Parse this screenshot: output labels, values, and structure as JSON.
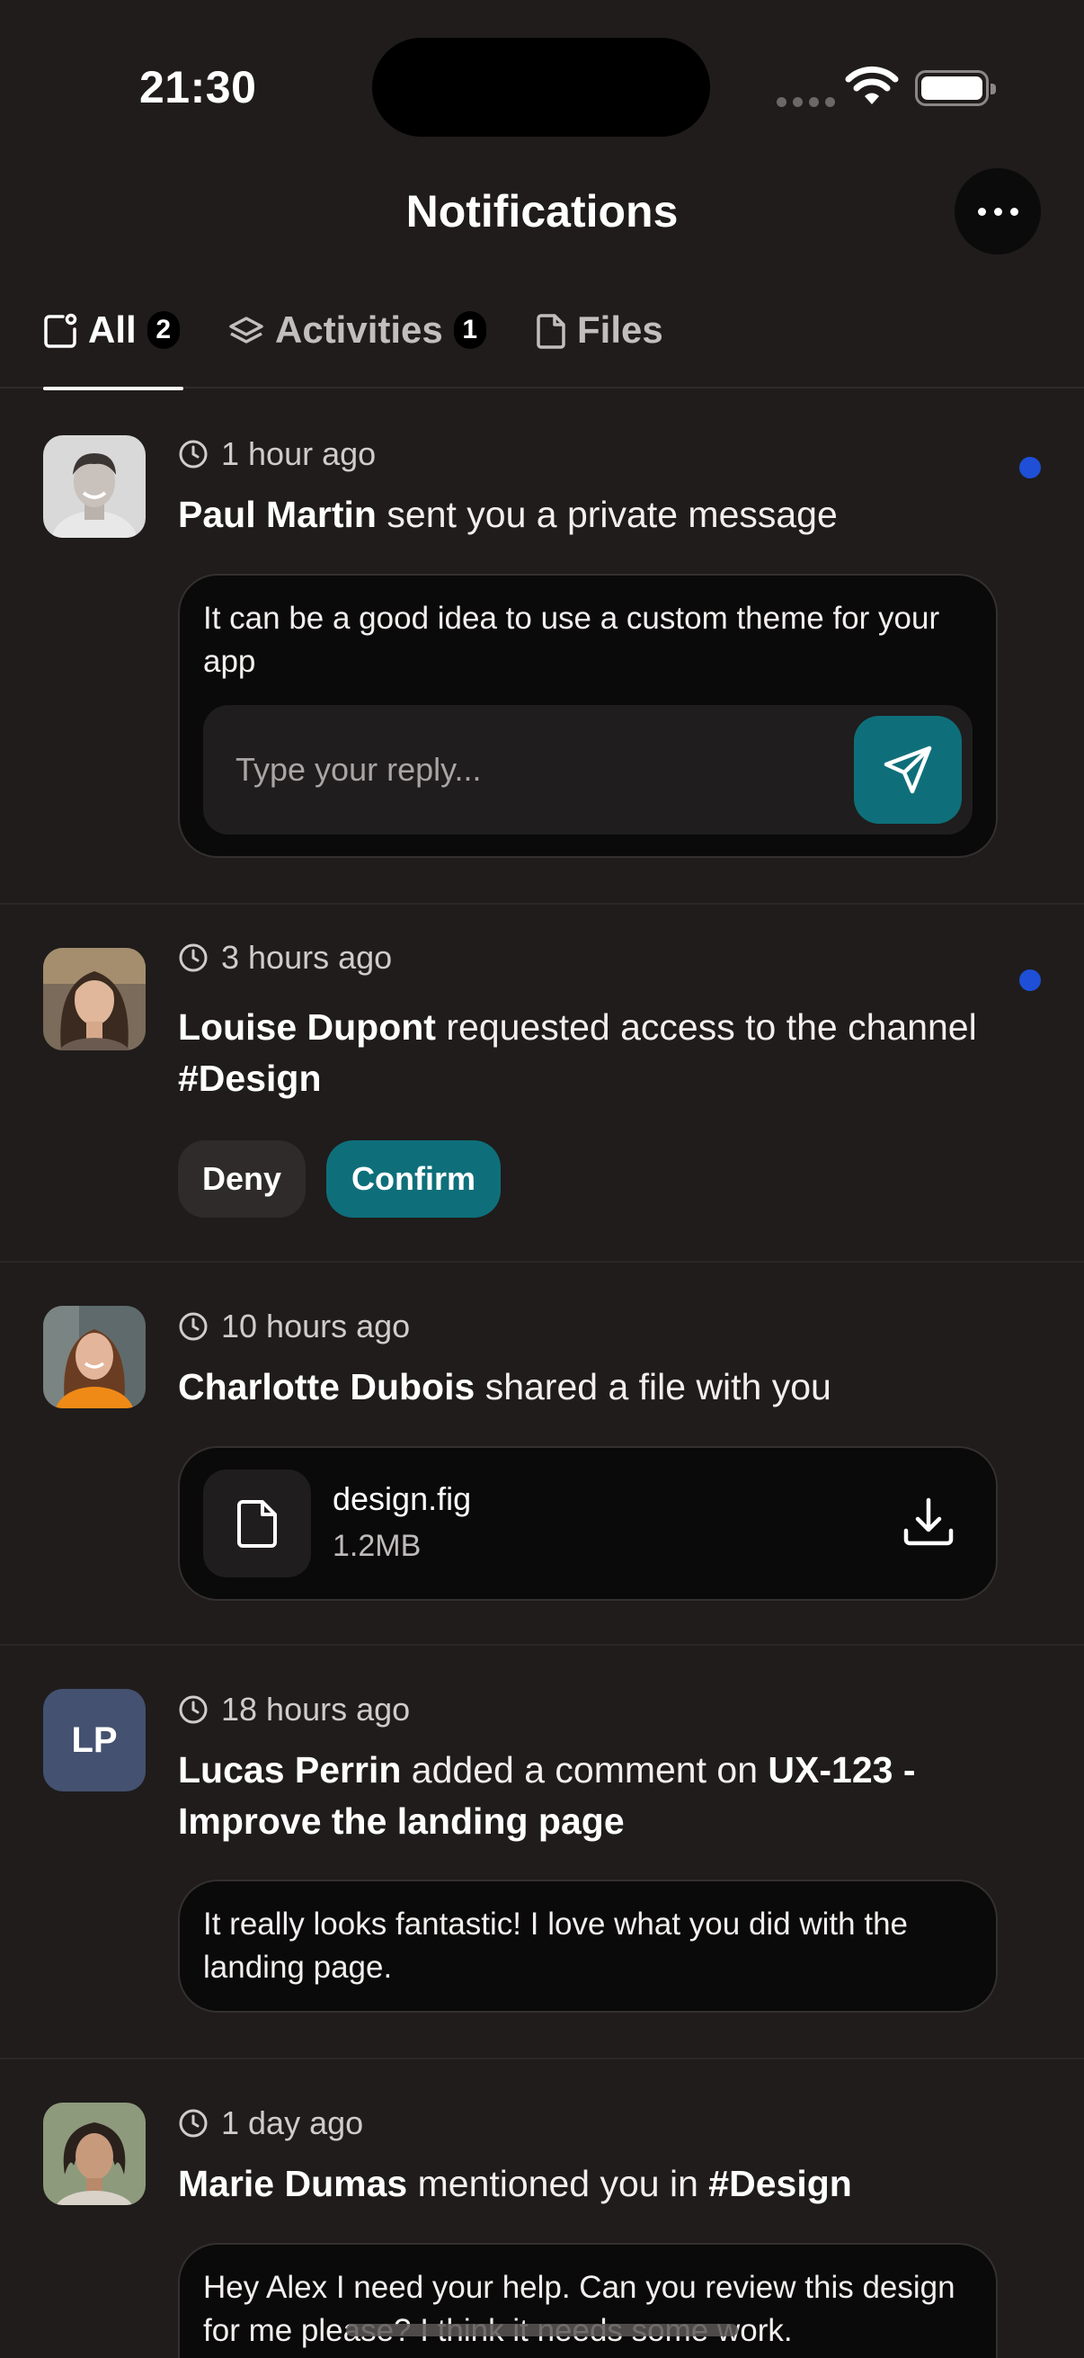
{
  "status_bar": {
    "time": "21:30"
  },
  "header": {
    "title": "Notifications",
    "more_icon": "ellipsis-icon"
  },
  "tabs": [
    {
      "label": "All",
      "count": "2",
      "icon": "inbox-icon",
      "active": true
    },
    {
      "label": "Activities",
      "count": "1",
      "icon": "layers-icon",
      "active": false
    },
    {
      "label": "Files",
      "icon": "file-icon",
      "active": false
    }
  ],
  "notifications": [
    {
      "time": "1 hour ago",
      "name": "Paul Martin",
      "action": "sent you a private message",
      "message": "It can be a good idea to use a custom theme for your app",
      "reply_placeholder": "Type your reply...",
      "unread": true
    },
    {
      "time": "3 hours ago",
      "name": "Louise Dupont",
      "action": "requested access to the channel",
      "target": "#Design",
      "deny_label": "Deny",
      "confirm_label": "Confirm",
      "unread": true
    },
    {
      "time": "10 hours ago",
      "name": "Charlotte Dubois",
      "action": "shared a file with you",
      "file_name": "design.fig",
      "file_size": "1.2MB"
    },
    {
      "time": "18 hours ago",
      "initials": "LP",
      "name": "Lucas Perrin",
      "action": "added a comment on",
      "target": "UX-123 - Improve the landing page",
      "comment": "It really looks fantastic! I love what you did with the landing page."
    },
    {
      "time": "1 day ago",
      "name": "Marie Dumas",
      "action": "mentioned you in",
      "target": "#Design",
      "message": "Hey Alex I need your help. Can you review this design for me please? I think it needs some work."
    }
  ],
  "colors": {
    "background": "#1f1c1b",
    "accent": "#0e6f7a",
    "unread_dot": "#1e4fd6",
    "initials_avatar": "#445170"
  }
}
